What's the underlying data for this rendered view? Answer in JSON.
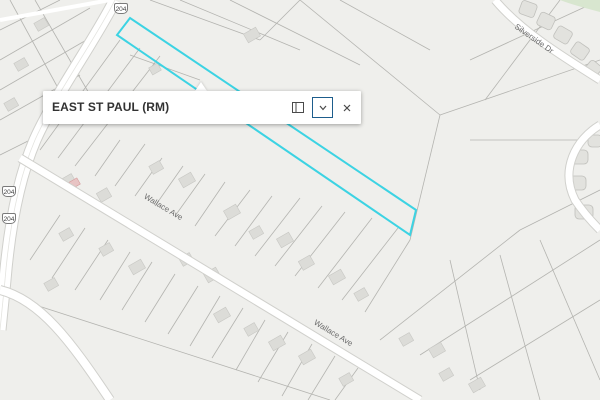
{
  "popup": {
    "title": "EAST ST PAUL (RM)",
    "dock_icon": "dock-panel-icon",
    "collapse_icon": "chevron-down-icon",
    "close_icon": "close-icon"
  },
  "map": {
    "road_labels": [
      "Wallace Ave",
      "Wallace Ave",
      "Silverside Dr"
    ],
    "highway_shields": [
      "204",
      "204",
      "204"
    ],
    "colors": {
      "background": "#efefec",
      "parcel_line": "#b4b4b0",
      "road_fill": "#ffffff",
      "highlight": "#3cd3e3",
      "building": "#dcdcd8",
      "focus_border": "#1d5d8c"
    }
  }
}
